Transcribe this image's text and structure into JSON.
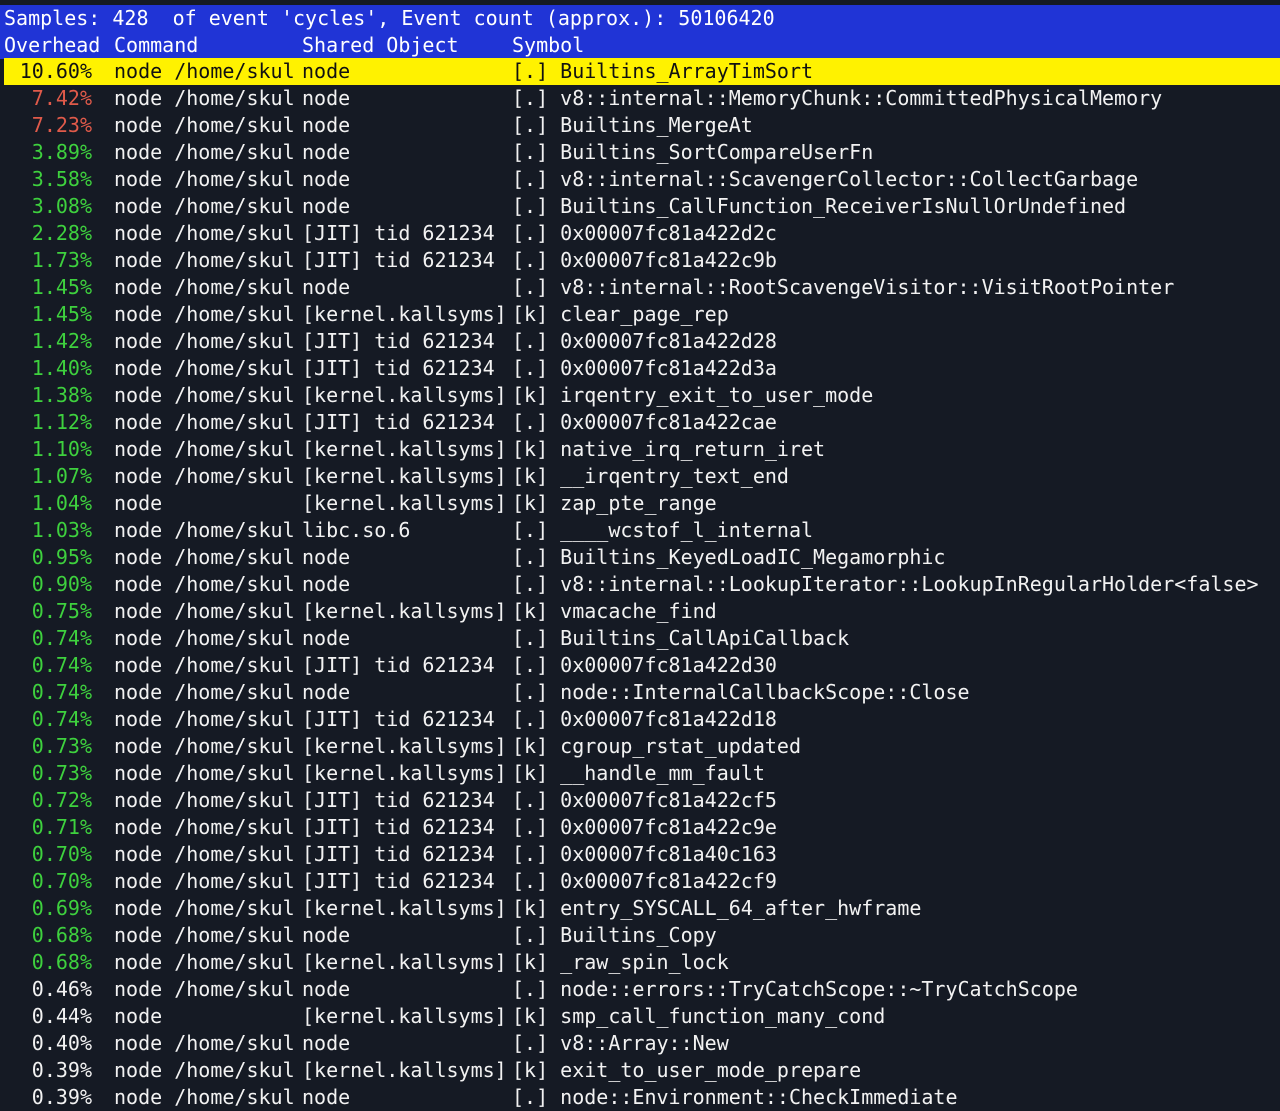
{
  "header": {
    "summary": "Samples: 428  of event 'cycles', Event count (approx.): 50106420",
    "columns": {
      "overhead": "Overhead",
      "command": "Command",
      "shared_object": "Shared Object",
      "symbol": "Symbol"
    }
  },
  "colors": {
    "header_bar": "#2034d6",
    "selected_row": "#fff200",
    "high_overhead": "#e05a4a",
    "mid_overhead": "#3ed13e",
    "low_overhead": "#f2f2f2",
    "background": "#151a24"
  },
  "rows": [
    {
      "overhead": "10.60%",
      "level": "selected",
      "command": "node /home/skul",
      "object": "node",
      "symbol": "[.] Builtins_ArrayTimSort"
    },
    {
      "overhead": "7.42%",
      "level": "red",
      "command": "node /home/skul",
      "object": "node",
      "symbol": "[.] v8::internal::MemoryChunk::CommittedPhysicalMemory"
    },
    {
      "overhead": "7.23%",
      "level": "red",
      "command": "node /home/skul",
      "object": "node",
      "symbol": "[.] Builtins_MergeAt"
    },
    {
      "overhead": "3.89%",
      "level": "green",
      "command": "node /home/skul",
      "object": "node",
      "symbol": "[.] Builtins_SortCompareUserFn"
    },
    {
      "overhead": "3.58%",
      "level": "green",
      "command": "node /home/skul",
      "object": "node",
      "symbol": "[.] v8::internal::ScavengerCollector::CollectGarbage"
    },
    {
      "overhead": "3.08%",
      "level": "green",
      "command": "node /home/skul",
      "object": "node",
      "symbol": "[.] Builtins_CallFunction_ReceiverIsNullOrUndefined"
    },
    {
      "overhead": "2.28%",
      "level": "green",
      "command": "node /home/skul",
      "object": "[JIT] tid 621234",
      "symbol": "[.] 0x00007fc81a422d2c"
    },
    {
      "overhead": "1.73%",
      "level": "green",
      "command": "node /home/skul",
      "object": "[JIT] tid 621234",
      "symbol": "[.] 0x00007fc81a422c9b"
    },
    {
      "overhead": "1.45%",
      "level": "green",
      "command": "node /home/skul",
      "object": "node",
      "symbol": "[.] v8::internal::RootScavengeVisitor::VisitRootPointer"
    },
    {
      "overhead": "1.45%",
      "level": "green",
      "command": "node /home/skul",
      "object": "[kernel.kallsyms]",
      "symbol": "[k] clear_page_rep"
    },
    {
      "overhead": "1.42%",
      "level": "green",
      "command": "node /home/skul",
      "object": "[JIT] tid 621234",
      "symbol": "[.] 0x00007fc81a422d28"
    },
    {
      "overhead": "1.40%",
      "level": "green",
      "command": "node /home/skul",
      "object": "[JIT] tid 621234",
      "symbol": "[.] 0x00007fc81a422d3a"
    },
    {
      "overhead": "1.38%",
      "level": "green",
      "command": "node /home/skul",
      "object": "[kernel.kallsyms]",
      "symbol": "[k] irqentry_exit_to_user_mode"
    },
    {
      "overhead": "1.12%",
      "level": "green",
      "command": "node /home/skul",
      "object": "[JIT] tid 621234",
      "symbol": "[.] 0x00007fc81a422cae"
    },
    {
      "overhead": "1.10%",
      "level": "green",
      "command": "node /home/skul",
      "object": "[kernel.kallsyms]",
      "symbol": "[k] native_irq_return_iret"
    },
    {
      "overhead": "1.07%",
      "level": "green",
      "command": "node /home/skul",
      "object": "[kernel.kallsyms]",
      "symbol": "[k] __irqentry_text_end"
    },
    {
      "overhead": "1.04%",
      "level": "green",
      "command": "node",
      "object": "[kernel.kallsyms]",
      "symbol": "[k] zap_pte_range"
    },
    {
      "overhead": "1.03%",
      "level": "green",
      "command": "node /home/skul",
      "object": "libc.so.6",
      "symbol": "[.] ____wcstof_l_internal"
    },
    {
      "overhead": "0.95%",
      "level": "green",
      "command": "node /home/skul",
      "object": "node",
      "symbol": "[.] Builtins_KeyedLoadIC_Megamorphic"
    },
    {
      "overhead": "0.90%",
      "level": "green",
      "command": "node /home/skul",
      "object": "node",
      "symbol": "[.] v8::internal::LookupIterator::LookupInRegularHolder<false>"
    },
    {
      "overhead": "0.75%",
      "level": "green",
      "command": "node /home/skul",
      "object": "[kernel.kallsyms]",
      "symbol": "[k] vmacache_find"
    },
    {
      "overhead": "0.74%",
      "level": "green",
      "command": "node /home/skul",
      "object": "node",
      "symbol": "[.] Builtins_CallApiCallback"
    },
    {
      "overhead": "0.74%",
      "level": "green",
      "command": "node /home/skul",
      "object": "[JIT] tid 621234",
      "symbol": "[.] 0x00007fc81a422d30"
    },
    {
      "overhead": "0.74%",
      "level": "green",
      "command": "node /home/skul",
      "object": "node",
      "symbol": "[.] node::InternalCallbackScope::Close"
    },
    {
      "overhead": "0.74%",
      "level": "green",
      "command": "node /home/skul",
      "object": "[JIT] tid 621234",
      "symbol": "[.] 0x00007fc81a422d18"
    },
    {
      "overhead": "0.73%",
      "level": "green",
      "command": "node /home/skul",
      "object": "[kernel.kallsyms]",
      "symbol": "[k] cgroup_rstat_updated"
    },
    {
      "overhead": "0.73%",
      "level": "green",
      "command": "node /home/skul",
      "object": "[kernel.kallsyms]",
      "symbol": "[k] __handle_mm_fault"
    },
    {
      "overhead": "0.72%",
      "level": "green",
      "command": "node /home/skul",
      "object": "[JIT] tid 621234",
      "symbol": "[.] 0x00007fc81a422cf5"
    },
    {
      "overhead": "0.71%",
      "level": "green",
      "command": "node /home/skul",
      "object": "[JIT] tid 621234",
      "symbol": "[.] 0x00007fc81a422c9e"
    },
    {
      "overhead": "0.70%",
      "level": "green",
      "command": "node /home/skul",
      "object": "[JIT] tid 621234",
      "symbol": "[.] 0x00007fc81a40c163"
    },
    {
      "overhead": "0.70%",
      "level": "green",
      "command": "node /home/skul",
      "object": "[JIT] tid 621234",
      "symbol": "[.] 0x00007fc81a422cf9"
    },
    {
      "overhead": "0.69%",
      "level": "green",
      "command": "node /home/skul",
      "object": "[kernel.kallsyms]",
      "symbol": "[k] entry_SYSCALL_64_after_hwframe"
    },
    {
      "overhead": "0.68%",
      "level": "green",
      "command": "node /home/skul",
      "object": "node",
      "symbol": "[.] Builtins_Copy"
    },
    {
      "overhead": "0.68%",
      "level": "green",
      "command": "node /home/skul",
      "object": "[kernel.kallsyms]",
      "symbol": "[k] _raw_spin_lock"
    },
    {
      "overhead": "0.46%",
      "level": "white",
      "command": "node /home/skul",
      "object": "node",
      "symbol": "[.] node::errors::TryCatchScope::~TryCatchScope"
    },
    {
      "overhead": "0.44%",
      "level": "white",
      "command": "node",
      "object": "[kernel.kallsyms]",
      "symbol": "[k] smp_call_function_many_cond"
    },
    {
      "overhead": "0.40%",
      "level": "white",
      "command": "node /home/skul",
      "object": "node",
      "symbol": "[.] v8::Array::New"
    },
    {
      "overhead": "0.39%",
      "level": "white",
      "command": "node /home/skul",
      "object": "[kernel.kallsyms]",
      "symbol": "[k] exit_to_user_mode_prepare"
    },
    {
      "overhead": "0.39%",
      "level": "white",
      "command": "node /home/skul",
      "object": "node",
      "symbol": "[.] node::Environment::CheckImmediate"
    }
  ]
}
